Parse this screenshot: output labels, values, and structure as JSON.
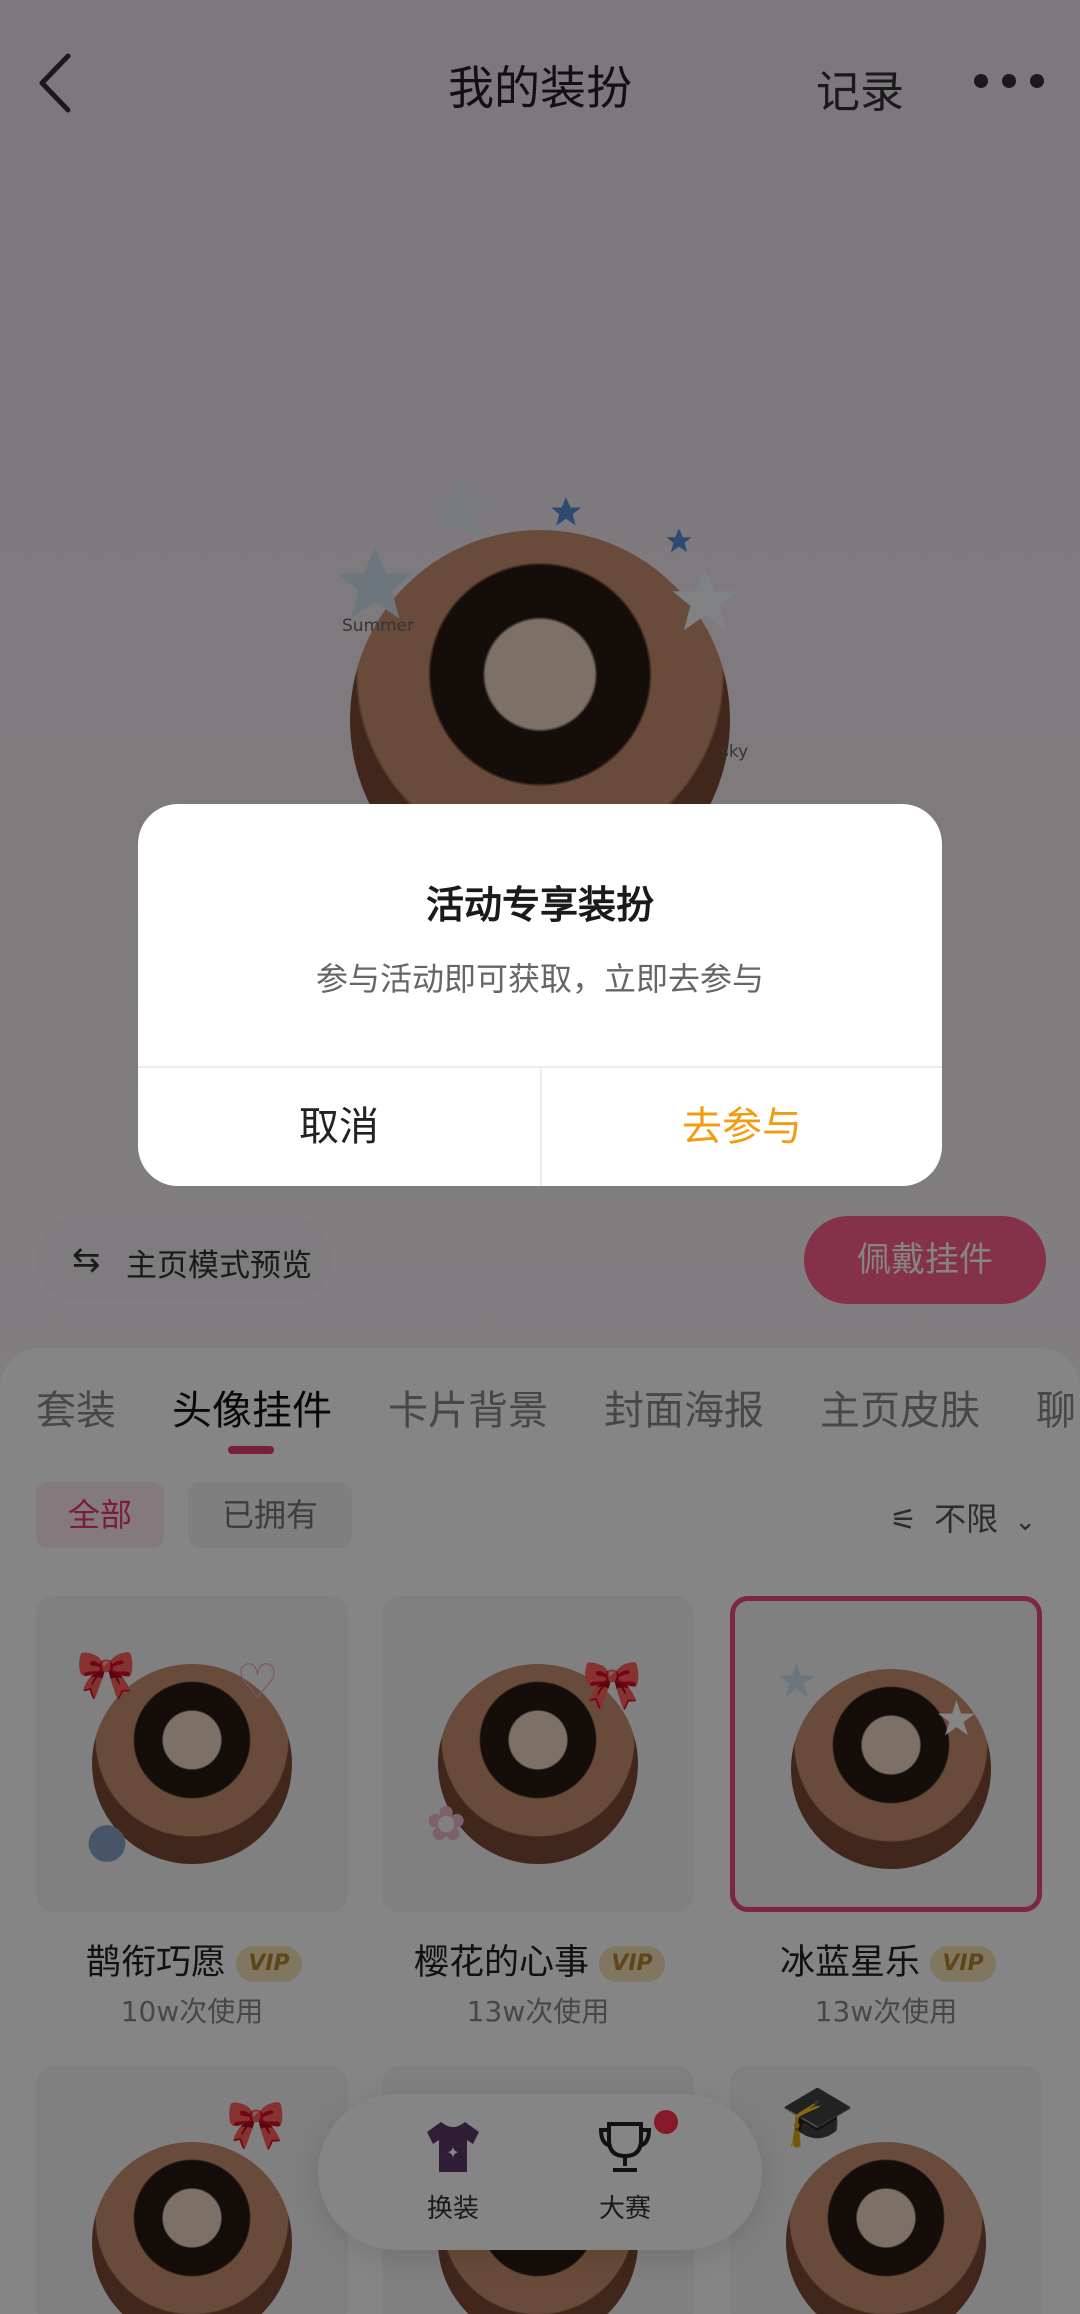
{
  "header": {
    "title": "我的装扮",
    "record_label": "记录"
  },
  "preview": {
    "label_left": "Summer",
    "label_right": "sky"
  },
  "mode_preview": {
    "label": "主页模式预览",
    "icon": "swap-arrows-icon"
  },
  "wear_button": {
    "label": "佩戴挂件"
  },
  "tabs": [
    {
      "label": "套装"
    },
    {
      "label": "头像挂件",
      "active": true
    },
    {
      "label": "卡片背景"
    },
    {
      "label": "封面海报"
    },
    {
      "label": "主页皮肤"
    },
    {
      "label": "聊"
    }
  ],
  "filters": {
    "all": "全部",
    "owned": "已拥有",
    "limit": "不限"
  },
  "cards": [
    {
      "name": "鹊衔巧愿",
      "vip": "VIP",
      "uses": "10w次使用",
      "selected": false
    },
    {
      "name": "樱花的心事",
      "vip": "VIP",
      "uses": "13w次使用",
      "selected": false
    },
    {
      "name": "冰蓝星乐",
      "vip": "VIP",
      "uses": "13w次使用",
      "selected": true
    }
  ],
  "bottom_nav": [
    {
      "label": "换装",
      "icon": "tshirt-icon"
    },
    {
      "label": "大赛",
      "icon": "trophy-icon",
      "badge": true
    }
  ],
  "dialog": {
    "title": "活动专享装扮",
    "message": "参与活动即可获取，立即去参与",
    "cancel": "取消",
    "confirm": "去参与"
  },
  "colors": {
    "accent_pink": "#ff5f8c",
    "confirm_orange": "#f39c12"
  }
}
